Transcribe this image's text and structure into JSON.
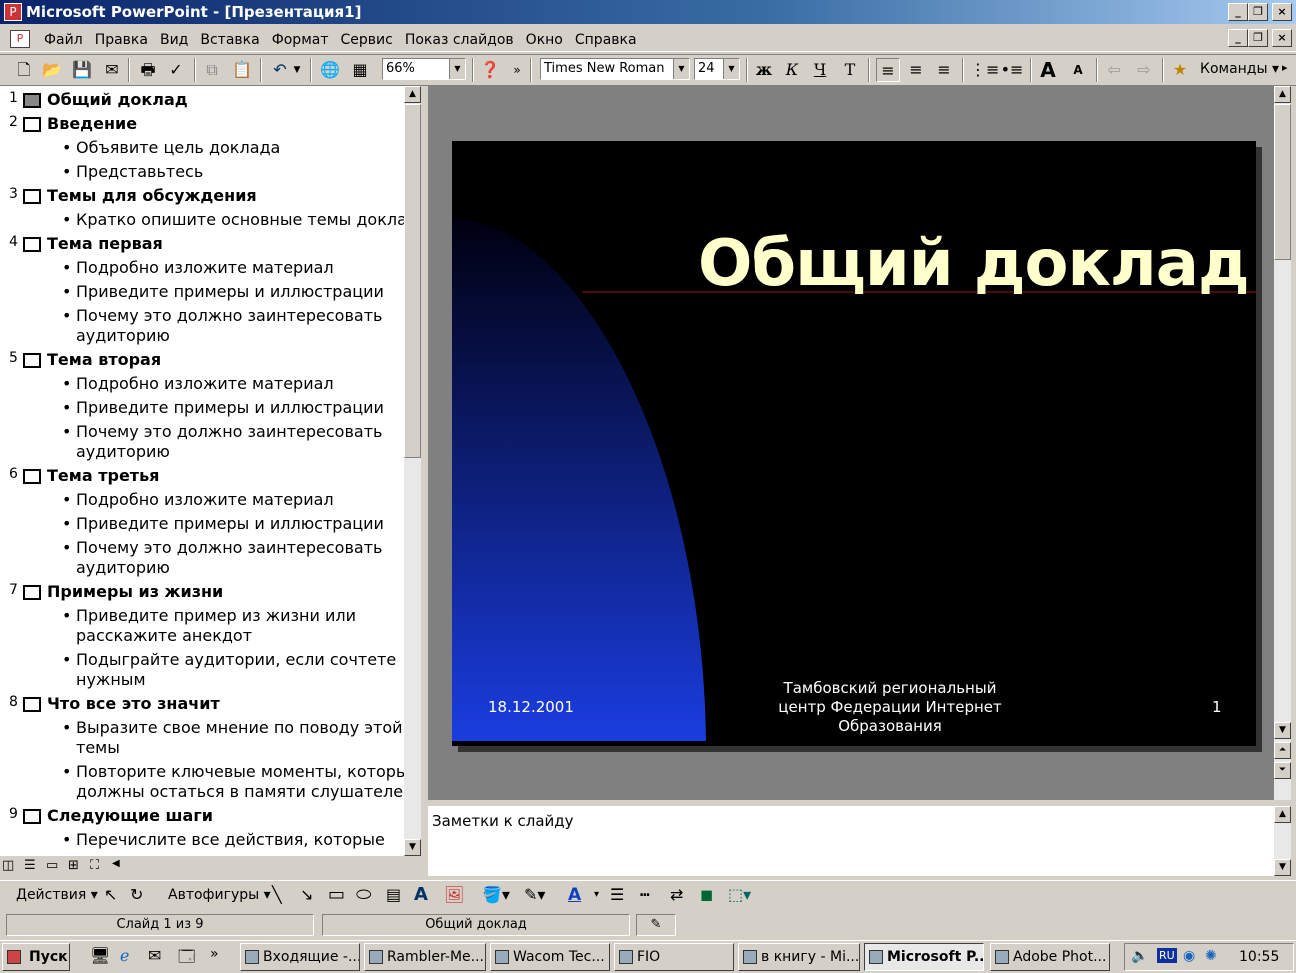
{
  "window": {
    "title": "Microsoft PowerPoint - [Презентация1]"
  },
  "menu": [
    "Файл",
    "Правка",
    "Вид",
    "Вставка",
    "Формат",
    "Сервис",
    "Показ слайдов",
    "Окно",
    "Справка"
  ],
  "toolbar": {
    "zoom": "66%",
    "font": "Times New Roman",
    "size": "24",
    "commands": "Команды"
  },
  "outline": [
    {
      "num": "1",
      "title": "Общий доклад",
      "selected": true,
      "bullets": []
    },
    {
      "num": "2",
      "title": "Введение",
      "bullets": [
        [
          "Объявите цель доклада"
        ],
        [
          "Представьтесь"
        ]
      ]
    },
    {
      "num": "3",
      "title": "Темы для обсуждения",
      "bullets": [
        [
          "Кратко опишите основные темы доклада"
        ]
      ]
    },
    {
      "num": "4",
      "title": "Тема первая",
      "bullets": [
        [
          "Подробно изложите материал"
        ],
        [
          "Приведите примеры и иллюстрации"
        ],
        [
          "Почему это должно заинтересовать",
          "аудиторию"
        ]
      ]
    },
    {
      "num": "5",
      "title": "Тема вторая",
      "bullets": [
        [
          "Подробно изложите материал"
        ],
        [
          "Приведите примеры и иллюстрации"
        ],
        [
          "Почему это должно заинтересовать",
          "аудиторию"
        ]
      ]
    },
    {
      "num": "6",
      "title": "Тема третья",
      "bullets": [
        [
          "Подробно изложите материал"
        ],
        [
          "Приведите примеры и иллюстрации"
        ],
        [
          "Почему это должно заинтересовать",
          "аудиторию"
        ]
      ]
    },
    {
      "num": "7",
      "title": "Примеры из жизни",
      "bullets": [
        [
          "Приведите пример из жизни или",
          "расскажите анекдот"
        ],
        [
          "Подыграйте аудитории, если сочтете",
          "нужным"
        ]
      ]
    },
    {
      "num": "8",
      "title": "Что все это значит",
      "bullets": [
        [
          "Выразите свое мнение по поводу этой",
          "темы"
        ],
        [
          "Повторите ключевые моменты, которые",
          "должны остаться в памяти слушателей"
        ]
      ]
    },
    {
      "num": "9",
      "title": "Следующие шаги",
      "bullets": [
        [
          "Перечислите все действия, которые"
        ]
      ]
    }
  ],
  "slide": {
    "title": "Общий доклад",
    "date": "18.12.2001",
    "footer_lines": [
      "Тамбовский региональный",
      "центр Федерации Интернет",
      "Образования"
    ],
    "number": "1"
  },
  "notes": {
    "placeholder": "Заметки к слайду"
  },
  "drawing": {
    "actions": "Действия",
    "autoshapes": "Автофигуры"
  },
  "status": {
    "slide": "Слайд 1 из 9",
    "design": "Общий доклад"
  },
  "taskbar": {
    "start": "Пуск",
    "tasks": [
      "Входящие -...",
      "Rambler-Ме...",
      "Wacom Tec...",
      "FIO",
      "в книгу - Mi...",
      "Microsoft P...",
      "Adobe Phot..."
    ],
    "lang": "RU",
    "clock": "10:55"
  },
  "colors": {
    "title_bar": "#0a246a",
    "slide_bg": "#000000",
    "slide_title": "#ffffcc",
    "gradient": "#1a3de0"
  }
}
